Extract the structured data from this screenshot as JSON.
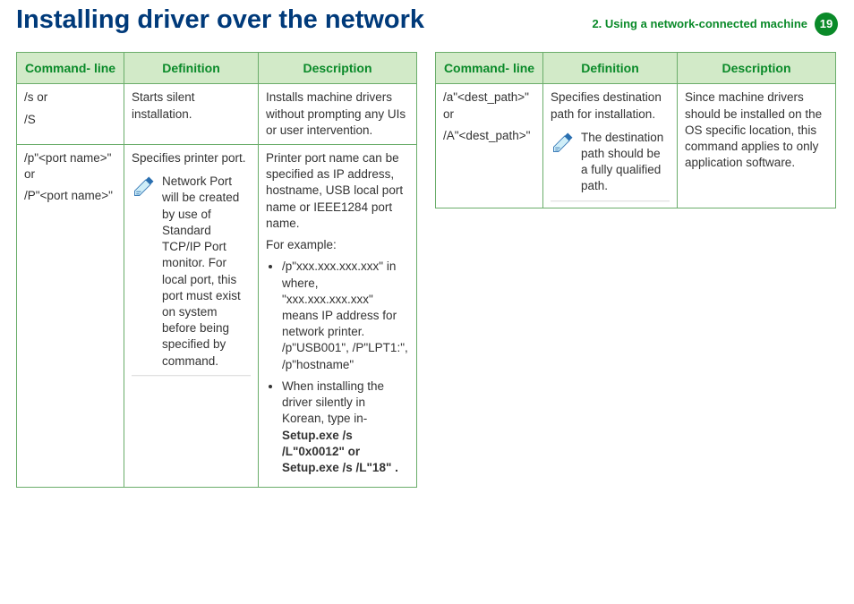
{
  "header": {
    "title": "Installing driver over the network",
    "chapter": "2.  Using a network-connected machine",
    "page": "19"
  },
  "table_headers": {
    "cmd": "Command- line",
    "def": "Definition",
    "desc": "Description"
  },
  "left": {
    "r1": {
      "cmd_a": "/s or",
      "cmd_b": "/S",
      "def": "Starts silent installation.",
      "desc": "Installs machine drivers without prompting any UIs or user intervention."
    },
    "r2": {
      "cmd_a": "/p\"<port name>\" or",
      "cmd_b": "/P\"<port name>\"",
      "def": "Specifies printer port.",
      "note": "Network Port will be created by use of Standard TCP/IP Port monitor. For local port, this port must exist on system before being specified by command.",
      "desc_p1": "Printer port name can be specified as IP address, hostname, USB local port name or IEEE1284 port name.",
      "desc_p2": "For example:",
      "bul1": "/p\"xxx.xxx.xxx.xxx\" in where, \"xxx.xxx.xxx.xxx\" means IP address for network printer. /p\"USB001\", /P\"LPT1:\", /p\"hostname\"",
      "bul2a": "When installing the driver silently in Korean, type in- ",
      "bul2b": "Setup.exe /s /L\"0x0012\" or Setup.exe /s /L\"18\" ."
    }
  },
  "right": {
    "r1": {
      "cmd_a": "/a\"<dest_path>\" or",
      "cmd_b": "/A\"<dest_path>\"",
      "def": "Specifies destination path for installation.",
      "note": "The destination path should be a fully qualified path.",
      "desc": "Since machine drivers should be installed on the OS specific location, this command applies to only application software."
    }
  }
}
